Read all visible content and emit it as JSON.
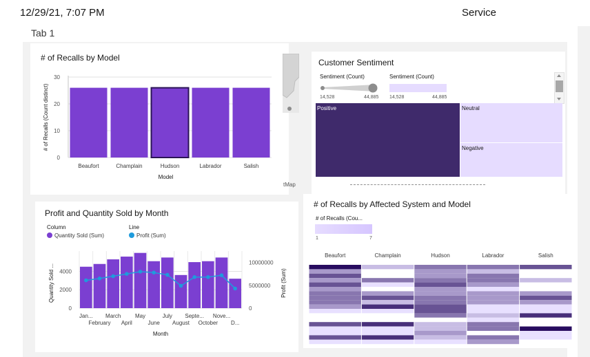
{
  "header": {
    "timestamp": "12/29/21, 7:07 PM",
    "app_name": "Service"
  },
  "tab": {
    "label": "Tab 1"
  },
  "colors": {
    "purple": "#7b3fd1",
    "dark_purple": "#3f2a6b",
    "light_purple": "#e6dcff",
    "blue": "#1f9bdc",
    "panel_bg": "#f2f2f2"
  },
  "recalls_by_model": {
    "title": "# of Recalls by Model",
    "chart_data": {
      "type": "bar",
      "title": "# of Recalls by Model",
      "xlabel": "Model",
      "ylabel": "# of Recalls (Count distinct)",
      "categories": [
        "Beaufort",
        "Champlain",
        "Hudson",
        "Labrador",
        "Salish"
      ],
      "values": [
        26,
        26,
        26,
        26,
        26
      ],
      "ylim": [
        0,
        30
      ],
      "yticks": [
        "0",
        "10",
        "20",
        "30"
      ],
      "selected": "Hudson"
    }
  },
  "map_fragment": {
    "label": "tMap"
  },
  "customer_sentiment": {
    "title": "Customer Sentiment",
    "legend_size": {
      "label": "Sentiment (Count)",
      "min": "14,528",
      "max": "44,885"
    },
    "legend_color": {
      "label": "Sentiment (Count)",
      "min": "14,528",
      "max": "44,885"
    },
    "treemap": [
      {
        "label": "Positive",
        "color": "#3f2a6b"
      },
      {
        "label": "Neutral",
        "color": "#e6dcff"
      },
      {
        "label": "Negative",
        "color": "#e6dcff"
      }
    ]
  },
  "profit_quantity": {
    "title": "Profit and Quantity Sold by Month",
    "legend": {
      "column_header": "Column",
      "column_item": "Quantity Sold (Sum)",
      "line_header": "Line",
      "line_item": "Profit (Sum)"
    },
    "chart_data": {
      "type": "bar",
      "title": "Profit and Quantity Sold by Month",
      "xlabel": "Month",
      "ylabel_left": "Quantity Sold ...",
      "ylabel_right": "Profit (Sum)",
      "categories": [
        "January",
        "February",
        "March",
        "April",
        "May",
        "June",
        "July",
        "August",
        "September",
        "October",
        "November",
        "December"
      ],
      "tick_labels_top": [
        "Jan...",
        "March",
        "May",
        "July",
        "Septe...",
        "Nove..."
      ],
      "tick_labels_bottom": [
        "February",
        "April",
        "June",
        "August",
        "October",
        "D..."
      ],
      "series": [
        {
          "name": "Quantity Sold (Sum)",
          "kind": "column",
          "values": [
            4500,
            4800,
            5300,
            5600,
            6000,
            5100,
            5500,
            3600,
            5000,
            5100,
            5500,
            3200
          ]
        },
        {
          "name": "Profit (Sum)",
          "kind": "line",
          "values": [
            6100000,
            6500000,
            7000000,
            7500000,
            8000000,
            7800000,
            7300000,
            4900000,
            6800000,
            6800000,
            7200000,
            4300000
          ]
        }
      ],
      "ylim_left": [
        0,
        6200
      ],
      "ylim_right": [
        0,
        12500000
      ],
      "yticks_left": [
        "0",
        "2000",
        "4000"
      ],
      "yticks_right": [
        "0",
        "5000000",
        "10000000"
      ]
    }
  },
  "heatmap": {
    "title": "# of Recalls by Affected System and Model",
    "legend": {
      "label": "# of Recalls (Cou...",
      "min": "1",
      "max": "7"
    },
    "chart_data": {
      "type": "heatmap",
      "title": "# of Recalls by Affected System and Model",
      "columns": [
        "Beaufort",
        "Champlain",
        "Hudson",
        "Labrador",
        "Salish"
      ],
      "values": [
        [
          7,
          2,
          4,
          4,
          5
        ],
        [
          3,
          0,
          3,
          2,
          0
        ],
        [
          5,
          0,
          3,
          4,
          0
        ],
        [
          3,
          4,
          4,
          4,
          2
        ],
        [
          5,
          1,
          5,
          3,
          0
        ],
        [
          3,
          0,
          3,
          1,
          0
        ],
        [
          4,
          3,
          3,
          3,
          3
        ],
        [
          4,
          5,
          4,
          3,
          5
        ],
        [
          4,
          2,
          4,
          3,
          3
        ],
        [
          3,
          6,
          5,
          1,
          1
        ],
        [
          1,
          1,
          5,
          1,
          1
        ],
        [
          0,
          0,
          4,
          2,
          6
        ],
        [
          0,
          0,
          0,
          1,
          0
        ],
        [
          5,
          6,
          2,
          4,
          0
        ],
        [
          1,
          1,
          2,
          4,
          7
        ],
        [
          1,
          1,
          3,
          0,
          1
        ],
        [
          5,
          6,
          2,
          4,
          1
        ],
        [
          1,
          1,
          1,
          3,
          0
        ]
      ]
    }
  }
}
